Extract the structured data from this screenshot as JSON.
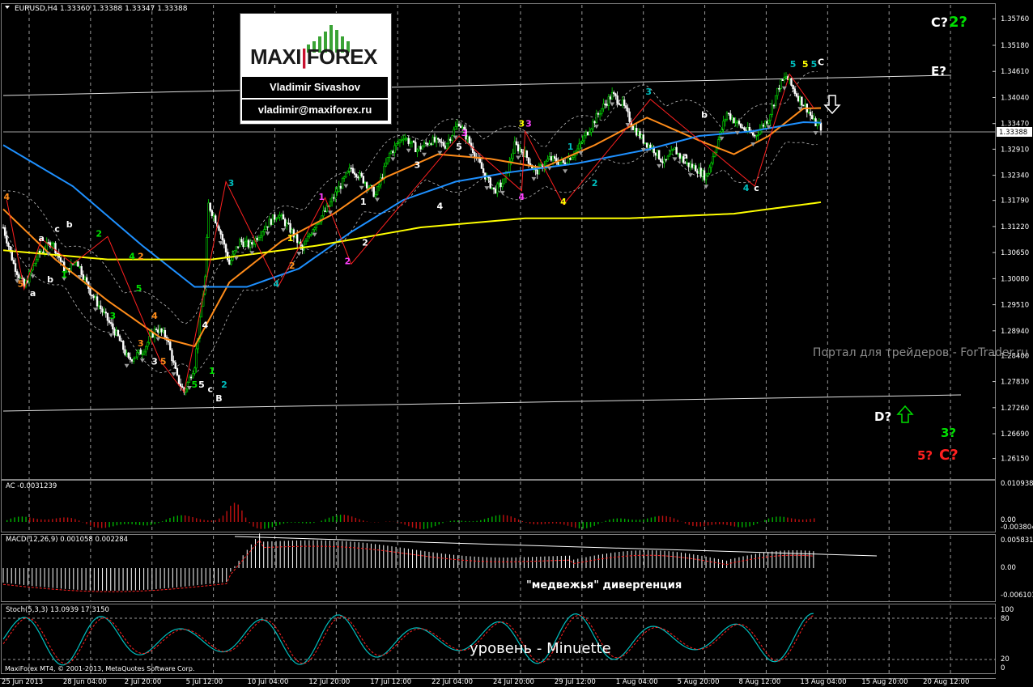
{
  "header": {
    "symbol_line": "EURUSD,H4  1.33360 1.33388 1.33347 1.33388"
  },
  "logo": {
    "brand_left": "MAXI",
    "brand_right": "FOREX",
    "name": "Vladimir Sivashov",
    "email": "vladimir@maxiforex.ru"
  },
  "watermark": "Портал для трейдеров - ForTrader.ru",
  "current_price_label": "1.33388",
  "footer": "MaxiForex MT4, © 2001-2013, MetaQuotes Software Corp.",
  "colors": {
    "background": "#000000",
    "bull_candle": "#00e000",
    "bear_candle": "#ffffff",
    "ma_fast": "#ff8c1a",
    "ma_mid": "#1e90ff",
    "ma_slow": "#ffff00",
    "wave_line": "#ff2020",
    "ac_up": "#00b000",
    "ac_down": "#c01010",
    "macd_hist": "#ffffff",
    "macd_signal": "#ff2020",
    "stoch_main": "#00bfbf",
    "stoch_signal": "#ff2020"
  },
  "panes": {
    "ac": {
      "label": "AC -0.0031239",
      "ticks": [
        "0.010938",
        "0.00",
        "-0.003804"
      ]
    },
    "macd": {
      "label": "MACD(12,26,9) 0.001058 0.002284",
      "ticks": [
        "0.005831",
        "0.00",
        "-0.006101"
      ],
      "annotation": "\"медвежья\" дивергенция"
    },
    "stoch": {
      "label": "Stoch(5,3,3) 13.0939 17.3150",
      "ticks": [
        "100",
        "80",
        "20",
        "0"
      ],
      "annotation": "уровень - Minuette"
    }
  },
  "annotations": {
    "targets": [
      {
        "text": "C?",
        "color": "#ffffff"
      },
      {
        "text": "2?",
        "color": "#00e000"
      },
      {
        "text": "E?",
        "color": "#ffffff"
      },
      {
        "text": "D?",
        "color": "#ffffff"
      },
      {
        "text": "3?",
        "color": "#00e000"
      },
      {
        "text": "5?",
        "color": "#ff2020"
      },
      {
        "text": "C?",
        "color": "#ff2020"
      }
    ],
    "arrows": [
      {
        "name": "arrow-down-icon",
        "direction": "down",
        "color": "#ffffff"
      },
      {
        "name": "arrow-up-icon",
        "direction": "up",
        "color": "#00e000"
      }
    ]
  },
  "chart_data": {
    "type": "candlestick",
    "symbol": "EURUSD",
    "timeframe": "H4",
    "ylim": [
      1.257,
      1.361
    ],
    "y_ticks": [
      "1.35760",
      "1.35180",
      "1.34610",
      "1.34040",
      "1.33470",
      "1.32910",
      "1.32340",
      "1.31790",
      "1.31220",
      "1.30650",
      "1.30080",
      "1.29510",
      "1.28940",
      "1.28400",
      "1.27830",
      "1.27260",
      "1.26690",
      "1.26150"
    ],
    "x_ticks": [
      "25 Jun 2013",
      "28 Jun 04:00",
      "2 Jul 20:00",
      "5 Jul 12:00",
      "10 Jul 04:00",
      "12 Jul 20:00",
      "17 Jul 12:00",
      "22 Jul 04:00",
      "24 Jul 20:00",
      "29 Jul 12:00",
      "1 Aug 04:00",
      "5 Aug 20:00",
      "8 Aug 12:00",
      "13 Aug 04:00",
      "15 Aug 20:00",
      "20 Aug 12:00"
    ],
    "price_path": [
      [
        0,
        1.312
      ],
      [
        6,
        1.304
      ],
      [
        12,
        1.299
      ],
      [
        20,
        1.306
      ],
      [
        28,
        1.309
      ],
      [
        36,
        1.302
      ],
      [
        42,
        1.305
      ],
      [
        50,
        1.298
      ],
      [
        58,
        1.293
      ],
      [
        66,
        1.288
      ],
      [
        72,
        1.283
      ],
      [
        80,
        1.285
      ],
      [
        88,
        1.29
      ],
      [
        94,
        1.288
      ],
      [
        100,
        1.279
      ],
      [
        104,
        1.276
      ],
      [
        110,
        1.282
      ],
      [
        116,
        1.301
      ],
      [
        118,
        1.317
      ],
      [
        124,
        1.312
      ],
      [
        130,
        1.304
      ],
      [
        136,
        1.309
      ],
      [
        142,
        1.308
      ],
      [
        150,
        1.312
      ],
      [
        158,
        1.315
      ],
      [
        166,
        1.311
      ],
      [
        172,
        1.307
      ],
      [
        178,
        1.312
      ],
      [
        186,
        1.316
      ],
      [
        192,
        1.32
      ],
      [
        200,
        1.325
      ],
      [
        208,
        1.322
      ],
      [
        214,
        1.319
      ],
      [
        222,
        1.328
      ],
      [
        230,
        1.332
      ],
      [
        238,
        1.329
      ],
      [
        246,
        1.331
      ],
      [
        254,
        1.33
      ],
      [
        262,
        1.335
      ],
      [
        270,
        1.329
      ],
      [
        276,
        1.324
      ],
      [
        282,
        1.32
      ],
      [
        288,
        1.322
      ],
      [
        294,
        1.33
      ],
      [
        300,
        1.328
      ],
      [
        306,
        1.324
      ],
      [
        314,
        1.327
      ],
      [
        322,
        1.326
      ],
      [
        330,
        1.329
      ],
      [
        336,
        1.333
      ],
      [
        344,
        1.338
      ],
      [
        350,
        1.341
      ],
      [
        356,
        1.339
      ],
      [
        362,
        1.334
      ],
      [
        368,
        1.331
      ],
      [
        374,
        1.329
      ],
      [
        380,
        1.326
      ],
      [
        386,
        1.329
      ],
      [
        392,
        1.326
      ],
      [
        398,
        1.325
      ],
      [
        404,
        1.323
      ],
      [
        410,
        1.33
      ],
      [
        416,
        1.337
      ],
      [
        424,
        1.334
      ],
      [
        432,
        1.332
      ],
      [
        440,
        1.336
      ],
      [
        446,
        1.343
      ],
      [
        450,
        1.345
      ],
      [
        456,
        1.341
      ],
      [
        462,
        1.338
      ],
      [
        466,
        1.335
      ],
      [
        470,
        1.3339
      ]
    ],
    "bar_count": 471,
    "moving_averages": [
      {
        "color": "#ff8c1a",
        "values": [
          [
            0,
            1.316
          ],
          [
            30,
            1.305
          ],
          [
            60,
            1.296
          ],
          [
            90,
            1.288
          ],
          [
            110,
            1.286
          ],
          [
            130,
            1.3
          ],
          [
            160,
            1.309
          ],
          [
            190,
            1.315
          ],
          [
            220,
            1.323
          ],
          [
            250,
            1.328
          ],
          [
            280,
            1.327
          ],
          [
            310,
            1.325
          ],
          [
            340,
            1.33
          ],
          [
            370,
            1.336
          ],
          [
            400,
            1.331
          ],
          [
            420,
            1.328
          ],
          [
            440,
            1.332
          ],
          [
            460,
            1.338
          ],
          [
            470,
            1.3381
          ]
        ]
      },
      {
        "color": "#1e90ff",
        "values": [
          [
            0,
            1.33
          ],
          [
            40,
            1.321
          ],
          [
            80,
            1.308
          ],
          [
            110,
            1.299
          ],
          [
            140,
            1.299
          ],
          [
            170,
            1.303
          ],
          [
            200,
            1.311
          ],
          [
            230,
            1.318
          ],
          [
            260,
            1.322
          ],
          [
            290,
            1.324
          ],
          [
            330,
            1.326
          ],
          [
            370,
            1.329
          ],
          [
            400,
            1.332
          ],
          [
            430,
            1.333
          ],
          [
            460,
            1.335
          ],
          [
            470,
            1.3349
          ]
        ]
      },
      {
        "color": "#ffff00",
        "values": [
          [
            0,
            1.307
          ],
          [
            60,
            1.305
          ],
          [
            120,
            1.305
          ],
          [
            180,
            1.308
          ],
          [
            240,
            1.312
          ],
          [
            300,
            1.314
          ],
          [
            360,
            1.314
          ],
          [
            420,
            1.315
          ],
          [
            470,
            1.3175
          ]
        ]
      }
    ],
    "wave_labels": [
      {
        "bar": 2,
        "price": 1.318,
        "text": "4",
        "color": "#ff8c1a"
      },
      {
        "bar": 10,
        "price": 1.299,
        "text": "5",
        "color": "#ff8c1a"
      },
      {
        "bar": 17,
        "price": 1.297,
        "text": "a",
        "color": "#ffffff"
      },
      {
        "bar": 22,
        "price": 1.309,
        "text": "a",
        "color": "#ffffff"
      },
      {
        "bar": 31,
        "price": 1.311,
        "text": "c",
        "color": "#ffffff"
      },
      {
        "bar": 38,
        "price": 1.312,
        "text": "b",
        "color": "#ffffff"
      },
      {
        "bar": 27,
        "price": 1.3,
        "text": "b",
        "color": "#ffffff"
      },
      {
        "bar": 35,
        "price": 1.301,
        "text": "1",
        "color": "#00e000"
      },
      {
        "bar": 55,
        "price": 1.31,
        "text": "2",
        "color": "#00e000"
      },
      {
        "bar": 74,
        "price": 1.305,
        "text": "4",
        "color": "#00e000"
      },
      {
        "bar": 79,
        "price": 1.305,
        "text": "2",
        "color": "#ff8c1a"
      },
      {
        "bar": 78,
        "price": 1.298,
        "text": "5",
        "color": "#00e000"
      },
      {
        "bar": 63,
        "price": 1.292,
        "text": "3",
        "color": "#00e000"
      },
      {
        "bar": 87,
        "price": 1.292,
        "text": "4",
        "color": "#ff8c1a"
      },
      {
        "bar": 79,
        "price": 1.286,
        "text": "3",
        "color": "#ff8c1a"
      },
      {
        "bar": 87,
        "price": 1.282,
        "text": "3",
        "color": "#ffffff"
      },
      {
        "bar": 92,
        "price": 1.282,
        "text": "5",
        "color": "#ff8c1a"
      },
      {
        "bar": 116,
        "price": 1.29,
        "text": "4",
        "color": "#ffffff"
      },
      {
        "bar": 110,
        "price": 1.277,
        "text": "5",
        "color": "#00e000"
      },
      {
        "bar": 114,
        "price": 1.277,
        "text": "5",
        "color": "#ffffff"
      },
      {
        "bar": 120,
        "price": 1.28,
        "text": "1",
        "color": "#00e000"
      },
      {
        "bar": 119,
        "price": 1.276,
        "text": "c",
        "color": "#ffffff"
      },
      {
        "bar": 124,
        "price": 1.274,
        "text": "B",
        "color": "#ffffff"
      },
      {
        "bar": 127,
        "price": 1.277,
        "text": "2",
        "color": "#00bfbf"
      },
      {
        "bar": 131,
        "price": 1.321,
        "text": "3",
        "color": "#00bfbf"
      },
      {
        "bar": 157,
        "price": 1.299,
        "text": "4",
        "color": "#00bfbf"
      },
      {
        "bar": 165,
        "price": 1.309,
        "text": "1",
        "color": "#ffff00"
      },
      {
        "bar": 166,
        "price": 1.303,
        "text": "2",
        "color": "#ff8c1a"
      },
      {
        "bar": 183,
        "price": 1.318,
        "text": "1",
        "color": "#ff40ff"
      },
      {
        "bar": 198,
        "price": 1.304,
        "text": "2",
        "color": "#ff40ff"
      },
      {
        "bar": 207,
        "price": 1.317,
        "text": "1",
        "color": "#ffffff"
      },
      {
        "bar": 208,
        "price": 1.308,
        "text": "2",
        "color": "#ffffff"
      },
      {
        "bar": 238,
        "price": 1.325,
        "text": "3",
        "color": "#ffffff"
      },
      {
        "bar": 251,
        "price": 1.316,
        "text": "4",
        "color": "#ffffff"
      },
      {
        "bar": 262,
        "price": 1.329,
        "text": "5",
        "color": "#ffffff"
      },
      {
        "bar": 265,
        "price": 1.332,
        "text": "3",
        "color": "#ff40ff"
      },
      {
        "bar": 298,
        "price": 1.318,
        "text": "4",
        "color": "#ff40ff"
      },
      {
        "bar": 298,
        "price": 1.334,
        "text": "3",
        "color": "#ffff00"
      },
      {
        "bar": 302,
        "price": 1.334,
        "text": "3",
        "color": "#ff40ff"
      },
      {
        "bar": 322,
        "price": 1.317,
        "text": "4",
        "color": "#ffff00"
      },
      {
        "bar": 326,
        "price": 1.329,
        "text": "1",
        "color": "#00bfbf"
      },
      {
        "bar": 340,
        "price": 1.321,
        "text": "2",
        "color": "#00bfbf"
      },
      {
        "bar": 371,
        "price": 1.341,
        "text": "3",
        "color": "#00bfbf"
      },
      {
        "bar": 392,
        "price": 1.327,
        "text": "a",
        "color": "#ffffff"
      },
      {
        "bar": 403,
        "price": 1.336,
        "text": "b",
        "color": "#ffffff"
      },
      {
        "bar": 427,
        "price": 1.32,
        "text": "4",
        "color": "#00bfbf"
      },
      {
        "bar": 433,
        "price": 1.32,
        "text": "c",
        "color": "#ffffff"
      },
      {
        "bar": 454,
        "price": 1.347,
        "text": "5",
        "color": "#00bfbf"
      },
      {
        "bar": 461,
        "price": 1.347,
        "text": "5",
        "color": "#ffff00"
      },
      {
        "bar": 466,
        "price": 1.347,
        "text": "5",
        "color": "#00bfbf"
      },
      {
        "bar": 470,
        "price": 1.3475,
        "text": "C",
        "color": "#ffffff"
      }
    ]
  }
}
